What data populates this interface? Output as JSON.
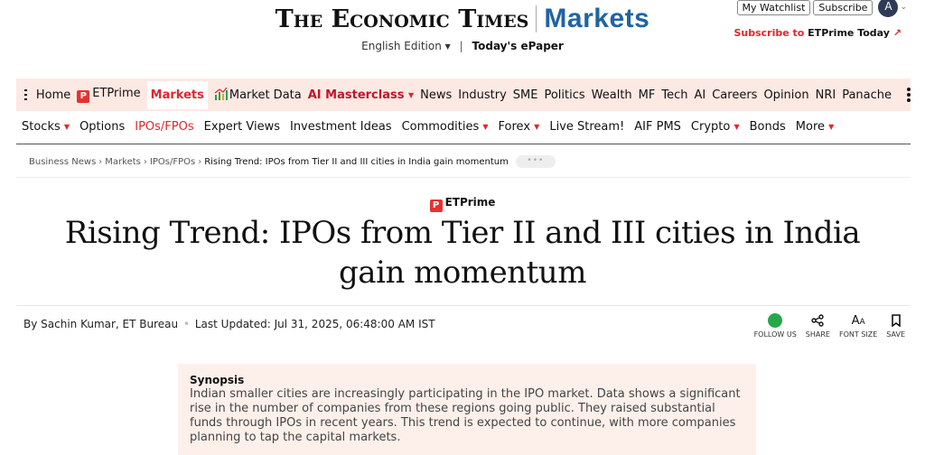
{
  "header": {
    "logo_et": "The Economic Times",
    "logo_markets": "Markets",
    "edition": "English Edition",
    "separator": "|",
    "epaper": "Today's ePaper",
    "watchlist": "My Watchlist",
    "subscribe": "Subscribe",
    "avatar_initial": "A",
    "subscribe_prime_prefix": "Subscribe to",
    "subscribe_prime_brand": "ETPrime Today",
    "subscribe_prime_arrow": "↗"
  },
  "nav": {
    "home": "Home",
    "etprime": "ETPrime",
    "markets": "Markets",
    "market_data": "Market Data",
    "masterclass": "AI Masterclass",
    "items": [
      "News",
      "Industry",
      "SME",
      "Politics",
      "Wealth",
      "MF",
      "Tech",
      "AI",
      "Careers",
      "Opinion",
      "NRI",
      "Panache"
    ]
  },
  "subnav": {
    "items": [
      {
        "label": "Stocks",
        "caret": true
      },
      {
        "label": "Options",
        "caret": false
      },
      {
        "label": "IPOs/FPOs",
        "caret": false,
        "active": true
      },
      {
        "label": "Expert Views",
        "caret": false
      },
      {
        "label": "Investment Ideas",
        "caret": false
      },
      {
        "label": "Commodities",
        "caret": true
      },
      {
        "label": "Forex",
        "caret": true
      },
      {
        "label": "Live Stream!",
        "caret": false
      },
      {
        "label": "AIF PMS",
        "caret": false
      },
      {
        "label": "Crypto",
        "caret": true
      },
      {
        "label": "Bonds",
        "caret": false
      },
      {
        "label": "More",
        "caret": true
      }
    ]
  },
  "breadcrumb": {
    "items": [
      "Business News",
      "Markets",
      "IPOs/FPOs"
    ],
    "current": "Rising Trend: IPOs from Tier II and III cities in India gain momentum",
    "more": "•••"
  },
  "article": {
    "kicker": "ETPrime",
    "headline": "Rising Trend: IPOs from Tier II and III cities in India gain momentum",
    "byline_author": "By Sachin Kumar, ET Bureau",
    "byline_dot": "•",
    "byline_updated": "Last Updated: Jul 31, 2025, 06:48:00 AM IST"
  },
  "actions": {
    "follow": "FOLLOW US",
    "share": "SHARE",
    "font_size": "FONT SIZE",
    "save": "SAVE"
  },
  "synopsis": {
    "title": "Synopsis",
    "body": "Indian smaller cities are increasingly participating in the IPO market. Data shows a significant rise in the number of companies from these regions going public. They raised substantial funds through IPOs in recent years. This trend is expected to continue, with more companies planning to tap the capital markets."
  },
  "colors": {
    "accent_red": "#e0262d",
    "markets_blue": "#1f64a3",
    "nav_bg": "#fde9e3",
    "synopsis_bg": "#fdf0eb",
    "whatsapp_green": "#25a84a"
  }
}
